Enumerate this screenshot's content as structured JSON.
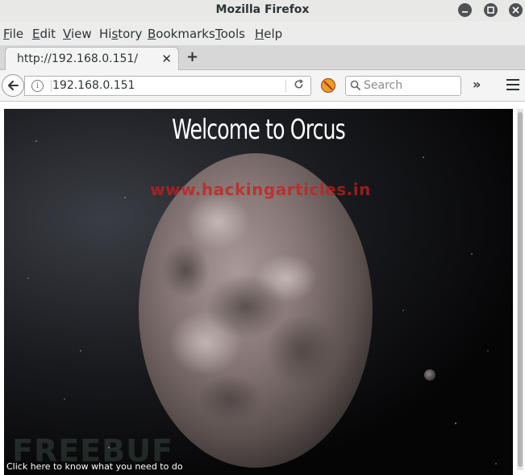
{
  "window": {
    "title": "Mozilla Firefox"
  },
  "menubar": {
    "items": [
      {
        "label": "File",
        "key": "F",
        "rest": "ile"
      },
      {
        "label": "Edit",
        "key": "E",
        "rest": "dit"
      },
      {
        "label": "View",
        "key": "V",
        "rest": "iew"
      },
      {
        "label": "History",
        "pre": "Hi",
        "key": "s",
        "rest": "tory"
      },
      {
        "label": "Bookmarks",
        "key": "B",
        "rest": "ookmarks"
      },
      {
        "label": "Tools",
        "key": "T",
        "rest": "ools"
      },
      {
        "label": "Help",
        "key": "H",
        "rest": "elp"
      }
    ]
  },
  "tabs": [
    {
      "label": "http://192.168.0.151/"
    }
  ],
  "navbar": {
    "url": "192.168.0.151",
    "search_placeholder": "Search"
  },
  "page": {
    "heading": "Welcome to Orcus",
    "watermark": "www.hackingarticles.in",
    "faint_logo": "FREEBUF",
    "link_text": "Click here to know what you need to do"
  },
  "icons": {
    "minimize": "minimize-icon",
    "maximize": "maximize-icon",
    "close": "close-icon",
    "back": "back-arrow-icon",
    "info": "info-icon",
    "reload": "reload-icon",
    "search": "search-icon",
    "overflow": "double-chevron-icon",
    "menu": "hamburger-icon",
    "addon": "addon-blocked-icon"
  },
  "colors": {
    "chrome_bg": "#ececec",
    "tab_active": "#f4f4f4",
    "watermark": "#c81e1e",
    "page_text": "#ffffff"
  }
}
